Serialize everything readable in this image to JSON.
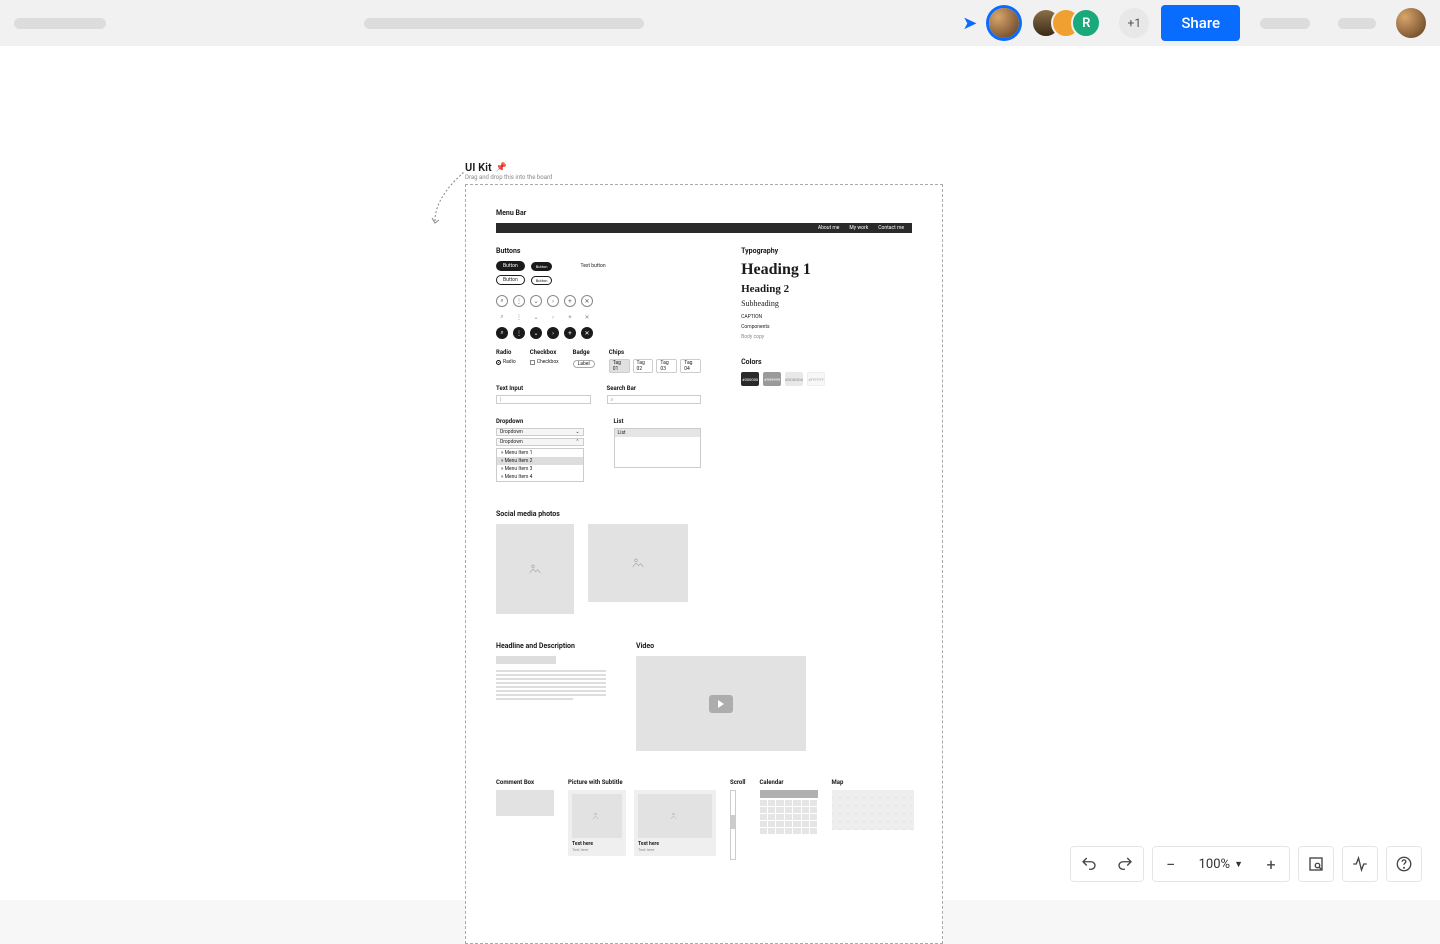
{
  "topbar": {
    "plus_count": "+1",
    "share_label": "Share",
    "stack_initial": "R"
  },
  "frame": {
    "title": "UI Kit",
    "pin": "📌",
    "subtitle": "Drag and drop this into the board"
  },
  "sections": {
    "menubar": {
      "title": "Menu Bar",
      "items": [
        "About me",
        "My work",
        "Contact me"
      ]
    },
    "buttons": {
      "title": "Buttons",
      "row1": [
        "Button",
        "Button"
      ],
      "text_btn": "Text button",
      "row2": [
        "Button",
        "Button"
      ]
    },
    "forms": {
      "radio": {
        "label": "Radio",
        "item": "Radio"
      },
      "checkbox": {
        "label": "Checkbox",
        "item": "Checkbox"
      },
      "badge": {
        "label": "Badge",
        "item": "Label"
      },
      "chips": {
        "label": "Chips",
        "items": [
          "Tag 01",
          "Tag 02",
          "Tag 03",
          "Tag 04"
        ]
      }
    },
    "textinput": {
      "label": "Text Input",
      "placeholder": "|"
    },
    "search": {
      "label": "Search Bar",
      "icon": "⌕"
    },
    "dropdown": {
      "label": "Dropdown",
      "closed": "Dropdown",
      "open": "Dropdown",
      "items": [
        "» Menu Item 1",
        "» Menu Item 2",
        "» Menu Item 3",
        "» Menu Item 4"
      ]
    },
    "list": {
      "label": "List",
      "header": "List"
    },
    "typography": {
      "title": "Typography",
      "h1": "Heading 1",
      "h2": "Heading 2",
      "sub": "Subheading",
      "caption": "CAPTION",
      "components": "Components",
      "body": "Body copy"
    },
    "colors": {
      "title": "Colors",
      "swatches": [
        "#000000",
        "#999999",
        "#DDDDDD",
        "#FFFFFF"
      ]
    },
    "social": {
      "title": "Social media photos"
    },
    "headline": {
      "title": "Headline and Description"
    },
    "video": {
      "title": "Video"
    },
    "comment": {
      "title": "Comment Box"
    },
    "picsub": {
      "title": "Picture with Subtitle",
      "text": "Text here",
      "sub": "Text here"
    },
    "scroll": {
      "title": "Scroll"
    },
    "calendar": {
      "title": "Calendar"
    },
    "map": {
      "title": "Map"
    }
  },
  "zoom": {
    "value": "100%"
  }
}
